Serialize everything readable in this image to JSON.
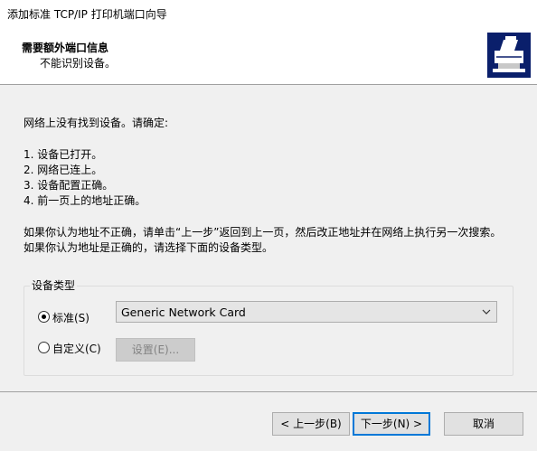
{
  "window": {
    "title": "添加标准 TCP/IP 打印机端口向导"
  },
  "header": {
    "title": "需要额外端口信息",
    "subtitle": "不能识别设备。",
    "icon": "printer-network-icon"
  },
  "body": {
    "intro": "网络上没有找到设备。请确定:",
    "checklist": [
      "1.   设备已打开。",
      "2.   网络已连上。",
      "3.   设备配置正确。",
      "4.   前一页上的地址正确。"
    ],
    "note_line1": "如果你认为地址不正确，请单击“上一步”返回到上一页，然后改正地址并在网络上执行另一次搜索。",
    "note_line2": "如果你认为地址是正确的，请选择下面的设备类型。"
  },
  "device_type": {
    "group_label": "设备类型",
    "standard_label": "标准(S)",
    "standard_checked": true,
    "standard_value": "Generic Network Card",
    "custom_label": "自定义(C)",
    "custom_checked": false,
    "settings_button": "设置(E)..."
  },
  "buttons": {
    "back": "< 上一步(B)",
    "next": "下一步(N) >",
    "cancel": "取消"
  },
  "colors": {
    "icon_bg": "#0a1f6b",
    "focus_border": "#0078d7"
  }
}
